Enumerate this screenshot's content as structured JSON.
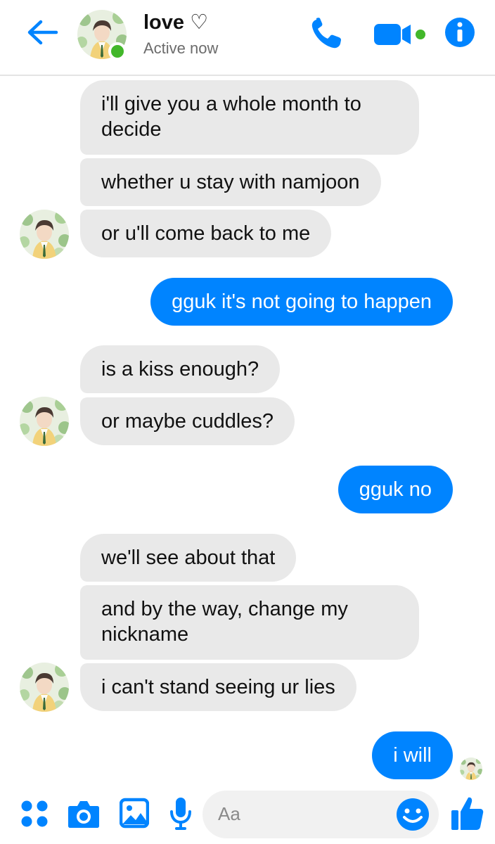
{
  "header": {
    "contact_name": "love ♡",
    "status": "Active now",
    "icons": [
      "back-arrow-icon",
      "phone-icon",
      "video-camera-icon",
      "info-icon"
    ]
  },
  "messages": [
    {
      "from": "them",
      "text": "i'll give you a whole month to"
    },
    {
      "from": "them",
      "text": "decide"
    },
    {
      "from": "them",
      "text": "whether u stay with namjoon"
    },
    {
      "from": "them",
      "text": "or u'll come back to me"
    },
    {
      "from": "me",
      "text": "gguk it's not going to happen"
    },
    {
      "from": "them",
      "text": "is a kiss enough?"
    },
    {
      "from": "them",
      "text": "or maybe cuddles?"
    },
    {
      "from": "me",
      "text": "gguk no"
    },
    {
      "from": "them",
      "text": "we'll see about that"
    },
    {
      "from": "them",
      "text": "and by the way, change my"
    },
    {
      "from": "them",
      "text": "nickname"
    },
    {
      "from": "them",
      "text": "i can't stand seeing ur lies"
    },
    {
      "from": "me",
      "text": "i will"
    }
  ],
  "composer": {
    "placeholder": "Aa",
    "icons": [
      "apps-icon",
      "camera-icon",
      "gallery-icon",
      "microphone-icon",
      "emoji-icon",
      "thumbs-up-icon"
    ]
  },
  "colors": {
    "accent": "#0084ff",
    "incoming_bubble": "#e9e9e9",
    "online": "#42b72a"
  }
}
